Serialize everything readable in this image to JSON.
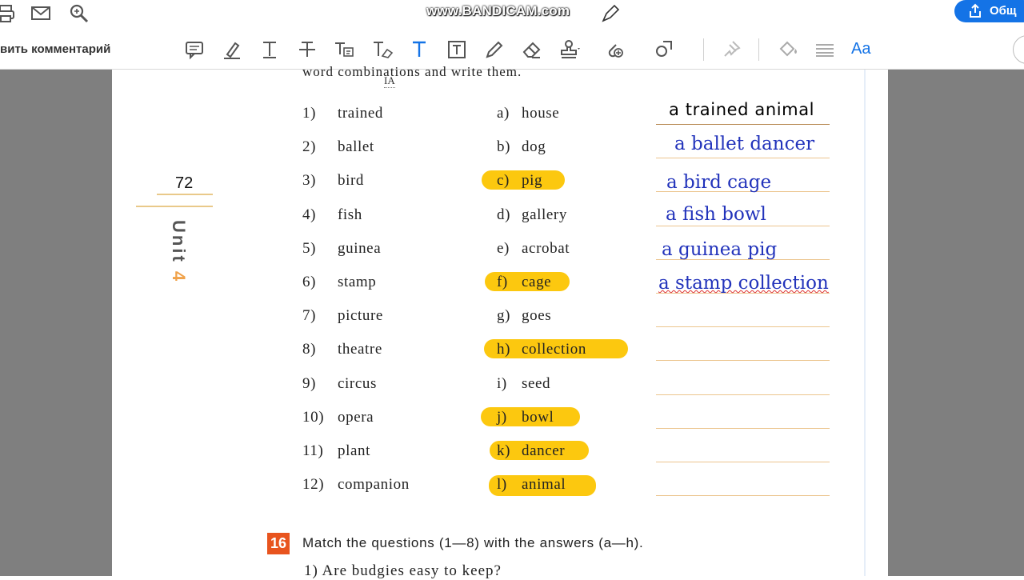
{
  "topbar": {
    "watermark": "www.BANDICAM.com",
    "share_label": "Общ"
  },
  "toolbar": {
    "label": "вить комментарий",
    "font_label": "Aa"
  },
  "page": {
    "page_number": "72",
    "unit_word": "Unit",
    "unit_number": "4",
    "instruction": "word combinations and write them.",
    "cursor_label": "A",
    "rows": [
      {
        "num": "1)",
        "word": "trained",
        "letter": "a)",
        "option": "house",
        "answer": "a  trained  animal",
        "highlight": false
      },
      {
        "num": "2)",
        "word": "ballet",
        "letter": "b)",
        "option": "dog",
        "answer": "a ballet dancer",
        "highlight": false
      },
      {
        "num": "3)",
        "word": "bird",
        "letter": "c)",
        "option": "pig",
        "answer": "a bird cage",
        "highlight": true
      },
      {
        "num": "4)",
        "word": "fish",
        "letter": "d)",
        "option": "gallery",
        "answer": "a fish bowl",
        "highlight": false
      },
      {
        "num": "5)",
        "word": "guinea",
        "letter": "e)",
        "option": "acrobat",
        "answer": "a guinea pig",
        "highlight": false
      },
      {
        "num": "6)",
        "word": "stamp",
        "letter": "f)",
        "option": "cage",
        "answer": "a stamp collection",
        "highlight": true
      },
      {
        "num": "7)",
        "word": "picture",
        "letter": "g)",
        "option": "goes",
        "answer": "",
        "highlight": false
      },
      {
        "num": "8)",
        "word": "theatre",
        "letter": "h)",
        "option": "collection",
        "answer": "",
        "highlight": true
      },
      {
        "num": "9)",
        "word": "circus",
        "letter": "i)",
        "option": "seed",
        "answer": "",
        "highlight": false
      },
      {
        "num": "10)",
        "word": "opera",
        "letter": "j)",
        "option": "bowl",
        "answer": "",
        "highlight": true
      },
      {
        "num": "11)",
        "word": "plant",
        "letter": "k)",
        "option": "dancer",
        "answer": "",
        "highlight": true
      },
      {
        "num": "12)",
        "word": "companion",
        "letter": "l)",
        "option": "animal",
        "answer": "",
        "highlight": true
      }
    ],
    "exercise": {
      "number": "16",
      "text": "Match the questions (1—8) with the answers (a—h).",
      "first_question": "1) Are budgies easy to keep?"
    }
  },
  "colors": {
    "highlight": "#fcc80f",
    "answer_ink": "#2233bb",
    "exercise_badge": "#e8541e",
    "accent_blue": "#1473e6"
  },
  "icons": [
    "print-icon",
    "mail-icon",
    "search-icon",
    "comment-icon",
    "highlight-icon",
    "text-icon",
    "strikethrough-icon",
    "replace-text-icon",
    "clear-text-icon",
    "add-text-icon",
    "text-box-icon",
    "pencil-icon",
    "eraser-icon",
    "stamp-icon",
    "attach-icon",
    "shapes-icon",
    "pin-icon",
    "fill-icon",
    "lines-icon"
  ]
}
